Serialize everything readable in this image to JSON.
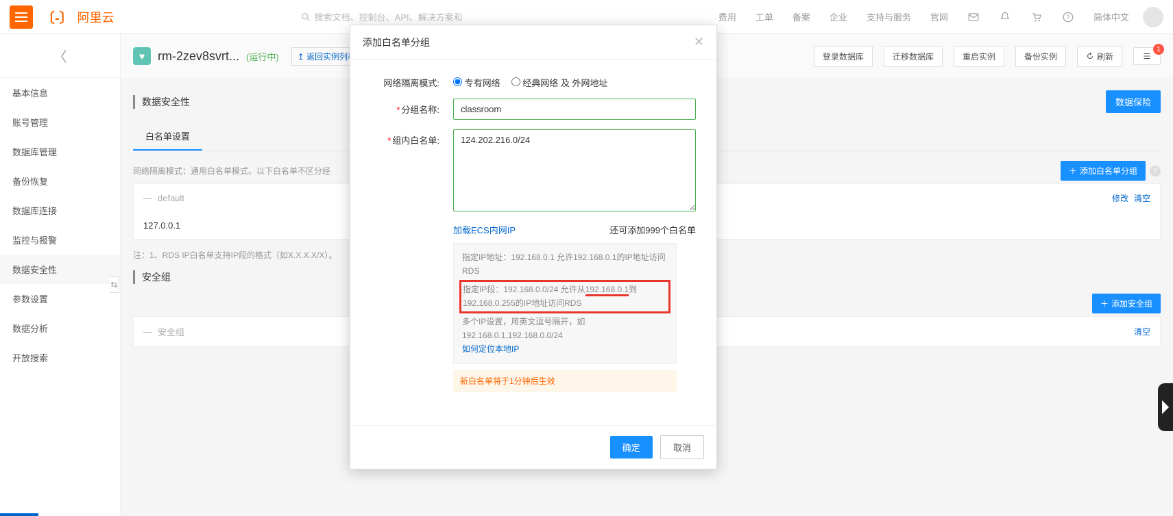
{
  "top": {
    "brand": "阿里云",
    "search_placeholder": "搜索文档、控制台、API、解决方案和",
    "links": [
      "费用",
      "工单",
      "备案",
      "企业",
      "支持与服务",
      "官网"
    ],
    "lang": "简体中文"
  },
  "sidebar": {
    "items": [
      "基本信息",
      "账号管理",
      "数据库管理",
      "备份恢复",
      "数据库连接",
      "监控与报警",
      "数据安全性",
      "参数设置",
      "数据分析",
      "开放搜索"
    ],
    "active_index": 6
  },
  "crumb": {
    "db_name": "rm-2zev8svrt...",
    "status": "(运行中)",
    "back": "返回实例列表",
    "actions": [
      "登录数据库",
      "迁移数据库",
      "重启实例",
      "备份实例"
    ],
    "refresh": "刷新",
    "badge_count": "1"
  },
  "section": {
    "title": "数据安全性",
    "insurance": "数据保险",
    "tab": "白名单设置",
    "mode_note": "网络隔离模式：通用白名单模式。以下白名单不区分经",
    "add_group": "添加白名单分组",
    "default_panel": "default",
    "default_ip": "127.0.0.1",
    "edit": "修改",
    "clear": "清空",
    "hint": "注：1、RDS IP白名单支持IP段的格式（如X.X.X.X/X）。",
    "security_group": "安全组",
    "security_group_panel": "安全组",
    "add_sg": "添加安全组"
  },
  "modal": {
    "title": "添加白名单分组",
    "isolation_label": "网络隔离模式:",
    "radio_vpc": "专有网络",
    "radio_classic": "经典网络 及 外网地址",
    "group_label": "分组名称:",
    "group_value": "classroom",
    "wl_label": "组内白名单:",
    "wl_value": "124.202.216.0/24",
    "load_ecs": "加载ECS内网IP",
    "remain": "还可添加999个白名单",
    "help_ip": "指定IP地址：192.168.0.1 允许192.168.0.1的IP地址访问RDS",
    "help_seg_a": "指定IP段：192.168.0.0/24 允许从",
    "help_seg_ip": "192.168.0.1",
    "help_seg_b": "到192.168.0.255的IP地址访问RDS",
    "help_multi": "多个IP设置，用英文逗号隔开，如192.168.0.1,192.168.0.0/24",
    "help_locate": "如何定位本地IP",
    "warn": "新白名单将于1分钟后生效",
    "ok": "确定",
    "cancel": "取消"
  }
}
